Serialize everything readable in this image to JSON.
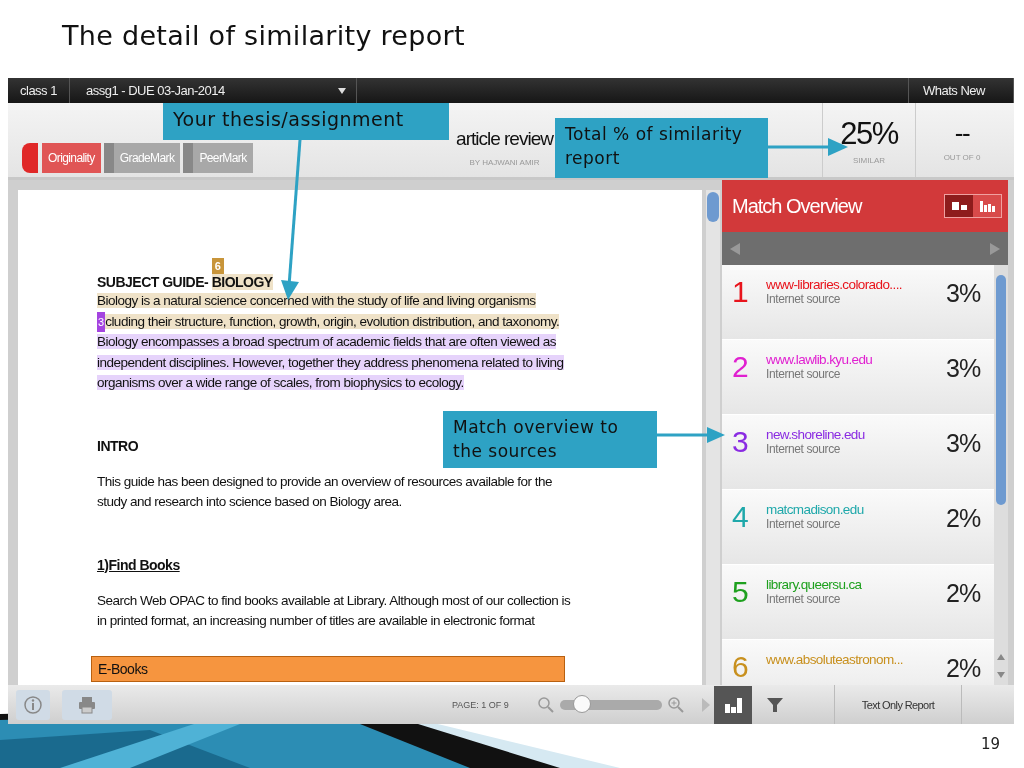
{
  "slide": {
    "title": "The detail of similarity report",
    "page_number": "19"
  },
  "top_bar": {
    "class_name": "class 1",
    "assignment": "assg1 - DUE 03-Jan-2014",
    "whats_new": "Whats New"
  },
  "header": {
    "tabs": [
      {
        "label": "Originality",
        "selected": true
      },
      {
        "label": "GradeMark",
        "selected": false
      },
      {
        "label": "PeerMark",
        "selected": false
      }
    ],
    "paper_title": "article review",
    "author": "BY HAJWANI AMIR",
    "similarity": {
      "value": "25%",
      "label": "SIMILAR"
    },
    "grade": {
      "value": "--",
      "label": "OUT OF 0"
    }
  },
  "document": {
    "blocks": [
      {
        "kind": "heading",
        "segments": [
          {
            "text": "SUBJECT GUIDE- "
          },
          {
            "text": "BIOLOGY",
            "color": "#efe2c8",
            "badge": {
              "text": "6",
              "color": "#c8953a"
            }
          }
        ]
      },
      {
        "kind": "paragraph",
        "lines": [
          [
            {
              "text": "Biology is a natural science concerned with the study of life and living organisms",
              "color": "#efe2c8"
            }
          ],
          [
            {
              "color": "#efe2c8",
              "badge": {
                "text": "3",
                "color": "#a444e0"
              }
            },
            {
              "text": "cluding their structure, function, growth, origin, evolution  distribution, and taxonomy.",
              "color": "#efe2c8"
            }
          ],
          [
            {
              "text": "Biology encompasses a broad spectrum of academic fields that are often viewed as",
              "color": "#e6d3fb"
            }
          ],
          [
            {
              "text": "independent disciplines. However, together they address phenomena related to living",
              "color": "#e6d3fb"
            }
          ],
          [
            {
              "text": "organisms over a wide range of scales, from biophysics to ecology.",
              "color": "#e6d3fb"
            }
          ]
        ]
      },
      {
        "kind": "heading",
        "segments": [
          {
            "text": "INTRO"
          }
        ]
      },
      {
        "kind": "paragraph",
        "lines": [
          [
            {
              "text": "This guide has been designed to provide an overview of resources available for the"
            }
          ],
          [
            {
              "text": "study and research into science based on Biology area."
            }
          ]
        ]
      },
      {
        "kind": "subheading",
        "segments": [
          {
            "text": "1)Find Books"
          }
        ]
      },
      {
        "kind": "paragraph",
        "lines": [
          [
            {
              "text": "Search Web OPAC to find books available at Library. Although most of our collection is"
            }
          ],
          [
            {
              "text": "in printed format, an increasing number of titles are available in electronic format"
            }
          ]
        ]
      },
      {
        "kind": "box",
        "text": "E-Books"
      }
    ]
  },
  "match_overview": {
    "title": "Match Overview",
    "views": [
      {
        "kind": "list",
        "selected": true
      },
      {
        "kind": "chart",
        "selected": false
      }
    ],
    "sources": [
      {
        "number": "1",
        "name": "www-libraries.colorado....",
        "type": "Internet source",
        "percent": "3%",
        "color": "#e8141c"
      },
      {
        "number": "2",
        "name": "www.lawlib.kyu.edu",
        "type": "Internet source",
        "percent": "3%",
        "color": "#e020d0"
      },
      {
        "number": "3",
        "name": "new.shoreline.edu",
        "type": "Internet source",
        "percent": "3%",
        "color": "#8a2be2"
      },
      {
        "number": "4",
        "name": "matcmadison.edu",
        "type": "Internet source",
        "percent": "2%",
        "color": "#1fa8aa"
      },
      {
        "number": "5",
        "name": "library.queersu.ca",
        "type": "Internet source",
        "percent": "2%",
        "color": "#1ea01e"
      },
      {
        "number": "6",
        "name": "www.absoluteastronom...",
        "percent": "2%",
        "color": "#c8901e"
      }
    ]
  },
  "toolbar": {
    "page": "PAGE:  1 OF 9",
    "zoom": {
      "level": 0.22
    },
    "side_buttons": [
      {
        "kind": "chart",
        "selected": true
      },
      {
        "kind": "filter",
        "selected": false
      }
    ],
    "text_only_report": "Text Only Report"
  },
  "callouts": [
    "Your thesis/assignment",
    "Total % of similarity report",
    "Match overview to the sources"
  ]
}
